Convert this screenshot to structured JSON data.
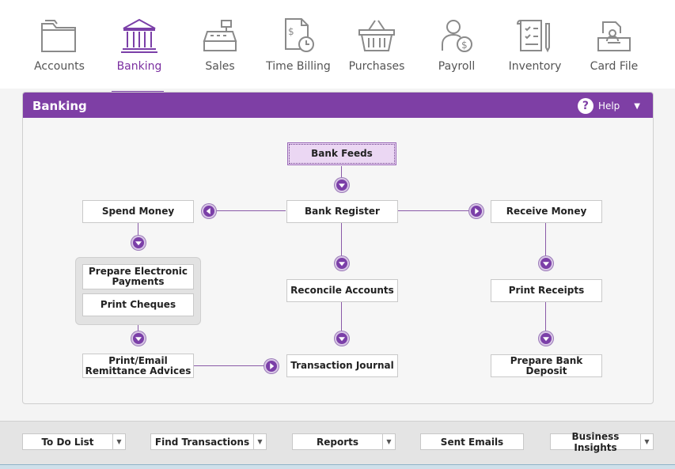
{
  "nav": {
    "items": [
      {
        "label": "Accounts",
        "icon": "folder-icon"
      },
      {
        "label": "Banking",
        "icon": "bank-icon"
      },
      {
        "label": "Sales",
        "icon": "cash-register-icon"
      },
      {
        "label": "Time Billing",
        "icon": "time-billing-icon"
      },
      {
        "label": "Purchases",
        "icon": "basket-icon"
      },
      {
        "label": "Payroll",
        "icon": "payroll-person-icon"
      },
      {
        "label": "Inventory",
        "icon": "clipboard-icon"
      },
      {
        "label": "Card File",
        "icon": "card-file-icon"
      }
    ],
    "active": "Banking"
  },
  "panel": {
    "title": "Banking",
    "help_label": "Help"
  },
  "flow": {
    "bank_feeds": "Bank Feeds",
    "spend_money": "Spend Money",
    "bank_register": "Bank Register",
    "receive_money": "Receive Money",
    "prepare_electronic_payments": "Prepare Electronic Payments",
    "print_cheques": "Print Cheques",
    "reconcile_accounts": "Reconcile Accounts",
    "print_receipts": "Print Receipts",
    "print_email_remittance": "Print/Email Remittance Advices",
    "transaction_journal": "Transaction Journal",
    "prepare_bank_deposit": "Prepare Bank Deposit"
  },
  "bottom": {
    "todo": "To Do List",
    "find": "Find Transactions",
    "reports": "Reports",
    "sent_emails": "Sent Emails",
    "business_insights": "Business Insights"
  },
  "colors": {
    "accent": "#7e3fa5",
    "active_text": "#7b2fa0"
  }
}
